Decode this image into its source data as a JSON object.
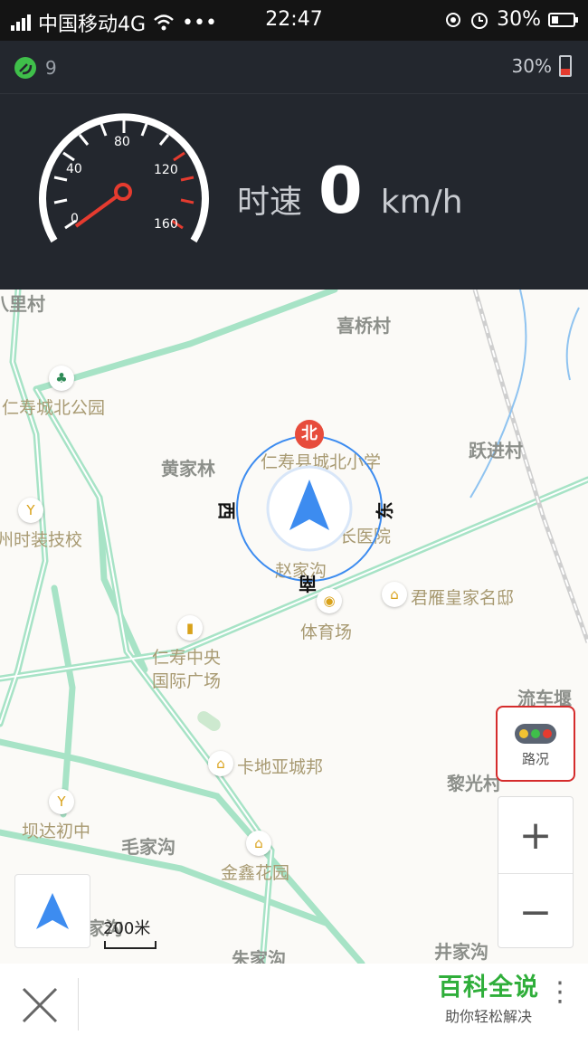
{
  "status_bar": {
    "carrier": "中国移动4G",
    "dots": "•••",
    "time": "22:47",
    "battery": "30%"
  },
  "gps_bar": {
    "satellites": "9",
    "battery": "30%"
  },
  "speed": {
    "label": "时速",
    "value": "0",
    "unit": "km/h",
    "gauge_ticks": [
      "0",
      "40",
      "80",
      "120",
      "160"
    ]
  },
  "compass": {
    "north": "北",
    "south": "南",
    "east": "东",
    "west": "西"
  },
  "map_labels": {
    "village_top_left": "八里村",
    "xiqiao": "喜桥村",
    "park": "仁寿城北公园",
    "huangjialin": "黄家林",
    "school": "仁寿县城北小学",
    "yuejin": "跃进村",
    "tech_school": "州时装技校",
    "hospital_partial": "长医院",
    "zhaojiagou": "赵家沟",
    "junyan": "君雁皇家名邸",
    "stadium": "体育场",
    "plaza_line1": "仁寿中央",
    "plaza_line2": "国际广场",
    "liuchehe": "流车堰",
    "kadiya": "卡地亚城邦",
    "liguang": "黎光村",
    "bada": "坝达初中",
    "maojiagou": "毛家沟",
    "jinxin": "金鑫花园",
    "jiagou_partial": "家沟",
    "zhujiagou": "朱家沟",
    "bottom_right_partial": "井家沟"
  },
  "controls": {
    "traffic_label": "路况",
    "zoom_in": "+",
    "zoom_out": "−",
    "scale": "200米"
  },
  "bottom": {
    "brand_title": "百科全说",
    "brand_subtitle": "助你轻松解决",
    "more": "⋮"
  },
  "colors": {
    "accent_blue": "#3d8cf0",
    "road_green": "#9fe0c0",
    "brand_green": "#2fae3a",
    "compass_red": "#e74c3c"
  }
}
